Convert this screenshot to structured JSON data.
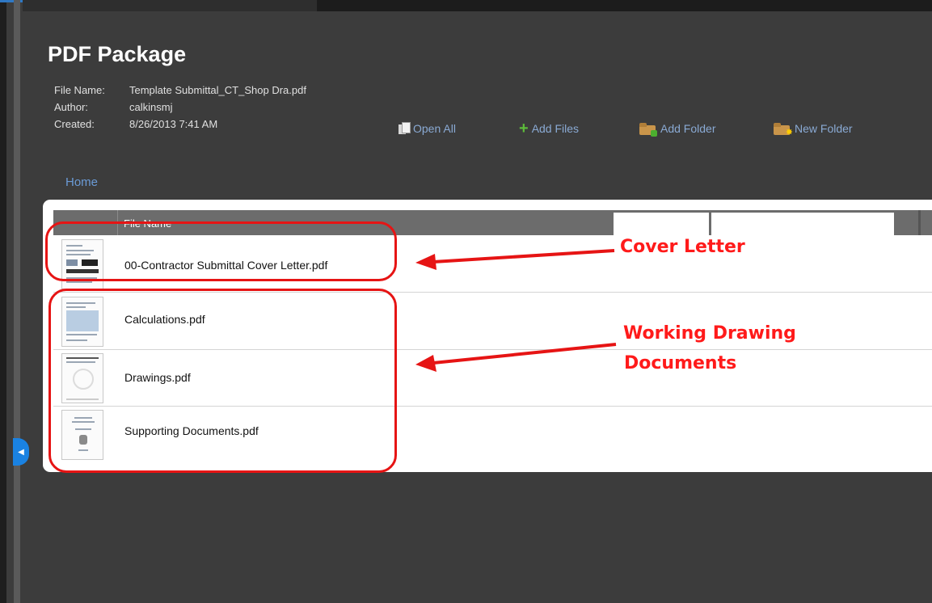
{
  "package": {
    "title": "PDF Package",
    "meta": [
      {
        "label": "File Name:",
        "value": "Template Submittal_CT_Shop Dra.pdf"
      },
      {
        "label": "Author:",
        "value": "calkinsmj"
      },
      {
        "label": "Created:",
        "value": "8/26/2013 7:41 AM"
      }
    ]
  },
  "toolbar": {
    "open_all": "Open All",
    "add_files": "Add Files",
    "add_folder": "Add Folder",
    "new_folder": "New Folder"
  },
  "breadcrumb": "Home",
  "table": {
    "column_file_name": "File Name",
    "files": [
      {
        "name": "00-Contractor Submittal Cover Letter.pdf"
      },
      {
        "name": "Calculations.pdf"
      },
      {
        "name": "Drawings.pdf"
      },
      {
        "name": "Supporting Documents.pdf"
      }
    ]
  },
  "annotations": {
    "cover_letter": "Cover Letter",
    "working_drawing_line1": "Working Drawing",
    "working_drawing_line2": "Documents",
    "color": "#e61414"
  },
  "icons": [
    "document-stack-icon",
    "plus-icon",
    "folder-add-icon",
    "folder-new-icon",
    "collapse-arrow-icon"
  ]
}
